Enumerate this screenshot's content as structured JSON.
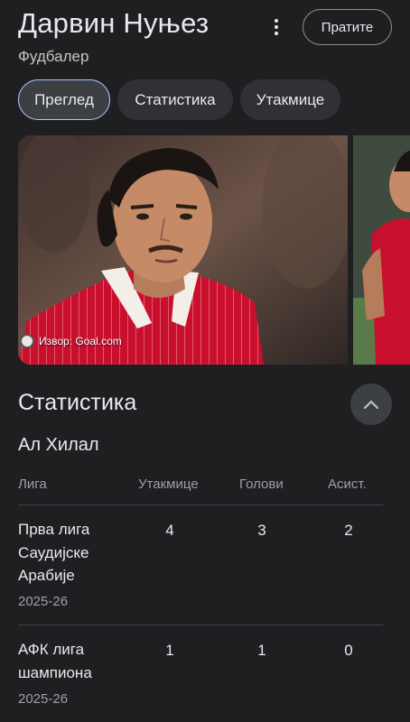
{
  "player": {
    "name": "Дарвин Нуњез",
    "role": "Фудбалер",
    "follow_label": "Пратите"
  },
  "tabs": [
    {
      "label": "Преглед",
      "active": true
    },
    {
      "label": "Статистика",
      "active": false
    },
    {
      "label": "Утакмице",
      "active": false
    }
  ],
  "gallery": {
    "source_label": "Извор: Goal.com"
  },
  "stats": {
    "section_title": "Статистика",
    "team": "Ал Хилал",
    "columns": [
      "Лига",
      "Утакмице",
      "Голови",
      "Асист."
    ],
    "rows": [
      {
        "league": "Прва лига Саудијске Арабије",
        "season": "2025-26",
        "matches": "4",
        "goals": "3",
        "assists": "2"
      },
      {
        "league": "АФК лига шампиона",
        "season": "2025-26",
        "matches": "1",
        "goals": "1",
        "assists": "0"
      }
    ]
  },
  "colors": {
    "background": "#1f1f22",
    "chip": "#303134",
    "active_outline": "#a8c7fa",
    "kit_red": "#c8102e"
  },
  "icons": {
    "more": "more-vertical-icon",
    "collapse": "chevron-up-icon",
    "source": "source-logo-icon"
  }
}
